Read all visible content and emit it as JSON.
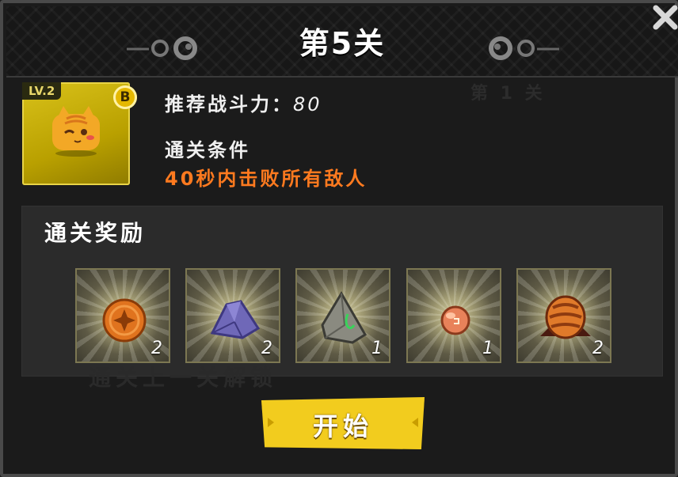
{
  "header": {
    "title": "第5关"
  },
  "level_card": {
    "level_tag": "LV.2",
    "grade": "B",
    "pet_icon": "yellow-cat-pet-icon"
  },
  "info": {
    "power_label": "推荐战斗力：",
    "power_value": "80",
    "condition_title": "通关条件",
    "condition_text": "40秒内击败所有敌人"
  },
  "background_ghosts": {
    "top_right": "第 1 关",
    "bottom": "通关上一关解锁"
  },
  "rewards": {
    "title": "通关奖励",
    "items": [
      {
        "icon": "orange-coin-icon",
        "count": "2"
      },
      {
        "icon": "purple-crystal-icon",
        "count": "2"
      },
      {
        "icon": "grey-rune-stone-icon",
        "count": "1"
      },
      {
        "icon": "copper-orb-icon",
        "count": "1"
      },
      {
        "icon": "striped-egg-icon",
        "count": "2"
      }
    ]
  },
  "start_button": {
    "label": "开始"
  },
  "colors": {
    "accent_yellow": "#f2cc1e",
    "condition_orange": "#ff7a1f",
    "panel_bg": "#2b2b2b"
  }
}
